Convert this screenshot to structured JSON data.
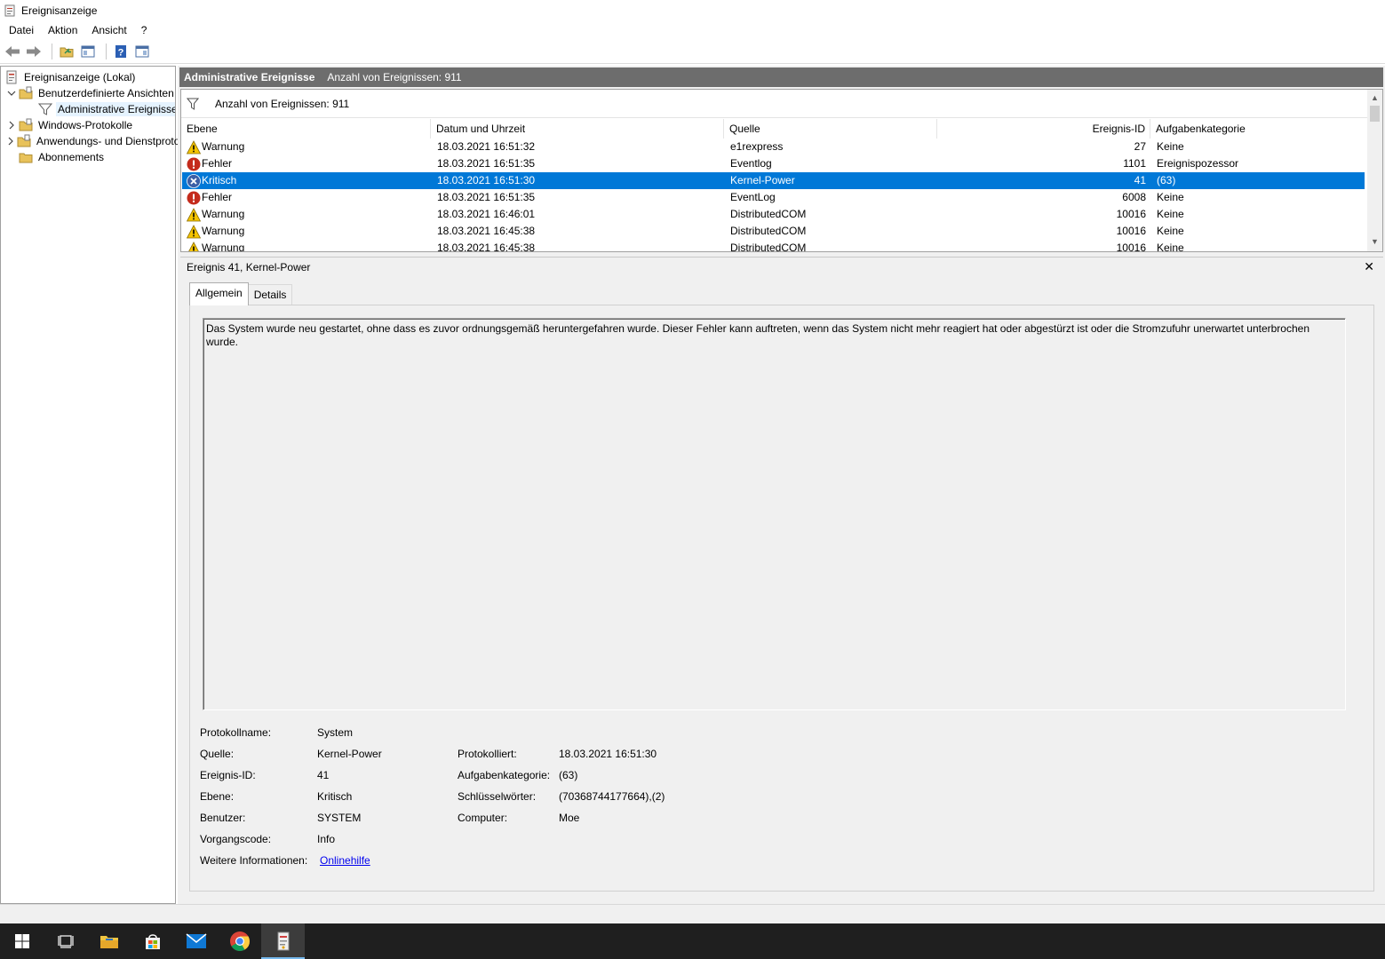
{
  "window": {
    "title": "Ereignisanzeige",
    "icon": "event-viewer-icon"
  },
  "menu": {
    "items": [
      "Datei",
      "Aktion",
      "Ansicht",
      "?"
    ]
  },
  "toolbar": {
    "buttons": [
      "back-arrow-icon",
      "forward-arrow-icon",
      "open-folder-icon",
      "show-hide-console-tree-icon",
      "help-icon",
      "show-hide-action-pane-icon"
    ]
  },
  "tree": {
    "items": [
      {
        "label": "Ereignisanzeige (Lokal)",
        "icon": "event-viewer-icon",
        "indent": 0,
        "expander": ""
      },
      {
        "label": "Benutzerdefinierte Ansichten",
        "icon": "folder-icon",
        "indent": 1,
        "expander": "expanded"
      },
      {
        "label": "Administrative Ereignisse",
        "icon": "filter-icon",
        "indent": 2,
        "expander": ""
      },
      {
        "label": "Windows-Protokolle",
        "icon": "folder-icon",
        "indent": 1,
        "expander": "collapsed"
      },
      {
        "label": "Anwendungs- und Dienstprotokolle",
        "icon": "folder-icon",
        "indent": 1,
        "expander": "collapsed"
      },
      {
        "label": "Abonnements",
        "icon": "folder-icon",
        "indent": 1,
        "expander": ""
      }
    ]
  },
  "view_header": {
    "title": "Administrative Ereignisse",
    "count_text": "Anzahl von Ereignissen: 911"
  },
  "filter_bar": {
    "text": "Anzahl von Ereignissen: 911"
  },
  "columns": [
    "Ebene",
    "Datum und Uhrzeit",
    "Quelle",
    "Ereignis-ID",
    "Aufgabenkategorie"
  ],
  "events": [
    {
      "level": "Warnung",
      "icon": "warning-icon",
      "datetime": "18.03.2021 16:51:32",
      "source": "e1rexpress",
      "id": "27",
      "category": "Keine"
    },
    {
      "level": "Fehler",
      "icon": "error-icon",
      "datetime": "18.03.2021 16:51:35",
      "source": "Eventlog",
      "id": "1101",
      "category": "Ereignispozessor"
    },
    {
      "level": "Kritisch",
      "icon": "critical-icon",
      "datetime": "18.03.2021 16:51:30",
      "source": "Kernel-Power",
      "id": "41",
      "category": "(63)"
    },
    {
      "level": "Fehler",
      "icon": "error-icon",
      "datetime": "18.03.2021 16:51:35",
      "source": "EventLog",
      "id": "6008",
      "category": "Keine"
    },
    {
      "level": "Warnung",
      "icon": "warning-icon",
      "datetime": "18.03.2021 16:46:01",
      "source": "DistributedCOM",
      "id": "10016",
      "category": "Keine"
    },
    {
      "level": "Warnung",
      "icon": "warning-icon",
      "datetime": "18.03.2021 16:45:38",
      "source": "DistributedCOM",
      "id": "10016",
      "category": "Keine"
    },
    {
      "level": "Warnung",
      "icon": "warning-icon",
      "datetime": "18.03.2021 16:45:38",
      "source": "DistributedCOM",
      "id": "10016",
      "category": "Keine"
    }
  ],
  "selected_event_index": 2,
  "detail": {
    "title": "Ereignis 41, Kernel-Power",
    "tabs": [
      "Allgemein",
      "Details"
    ],
    "description": "Das System wurde neu gestartet, ohne dass es zuvor ordnungsgemäß heruntergefahren wurde. Dieser Fehler kann auftreten, wenn das System nicht mehr reagiert hat oder abgestürzt ist oder die Stromzufuhr unerwartet unterbrochen wurde.",
    "fields": {
      "log_name": {
        "label": "Protokollname:",
        "value": "System"
      },
      "source": {
        "label": "Quelle:",
        "value": "Kernel-Power"
      },
      "event_id": {
        "label": "Ereignis-ID:",
        "value": "41"
      },
      "level": {
        "label": "Ebene:",
        "value": "Kritisch"
      },
      "user": {
        "label": "Benutzer:",
        "value": "SYSTEM"
      },
      "opcode": {
        "label": "Vorgangscode:",
        "value": "Info"
      },
      "more_info": {
        "label": "Weitere Informationen:",
        "value": "Onlinehilfe"
      },
      "logged": {
        "label": "Protokolliert:",
        "value": "18.03.2021 16:51:30"
      },
      "task_category": {
        "label": "Aufgabenkategorie:",
        "value": "(63)"
      },
      "keywords": {
        "label": "Schlüsselwörter:",
        "value": "(70368744177664),(2)"
      },
      "computer": {
        "label": "Computer:",
        "value": "Moe"
      }
    }
  },
  "taskbar": {
    "items": [
      "windows-start-icon",
      "task-view-icon",
      "file-explorer-icon",
      "store-icon",
      "mail-icon",
      "chrome-icon",
      "event-viewer-icon"
    ],
    "active_index": 6
  },
  "colors": {
    "selection": "#0078d7",
    "header_bar": "#6d6d6d",
    "taskbar": "#1f1f1f",
    "link": "#0000ee"
  }
}
